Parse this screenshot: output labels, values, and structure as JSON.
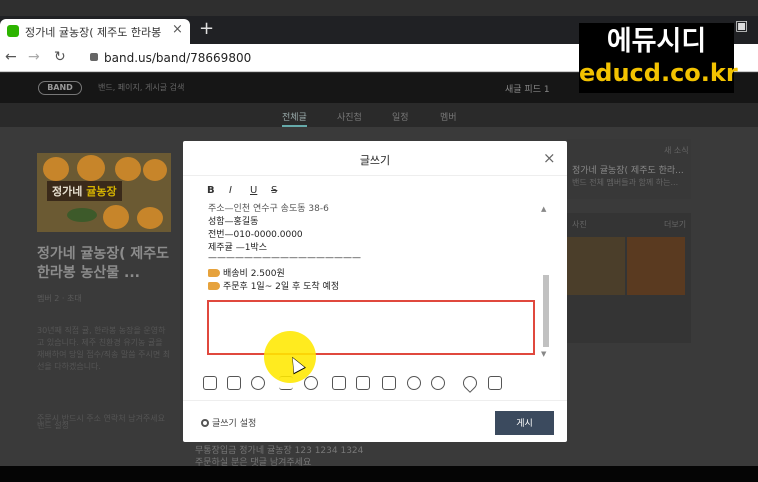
{
  "browser": {
    "tab_title": "정가네 귤농장( 제주도 한라봉 농",
    "tab_close": "×",
    "new_tab": "+",
    "url": "band.us/band/78669800",
    "back": "←",
    "forward": "→",
    "reload": "C"
  },
  "watermark": {
    "line1": "에듀시디",
    "line2": "educd.co.kr"
  },
  "band": {
    "logo": "BAND",
    "search_placeholder": "밴드, 페이지, 게시글 검색",
    "nav_right": "새글 피드  1",
    "tabs": [
      "전체글",
      "사진첩",
      "일정",
      "멤버"
    ],
    "cover_label_a": "정가네 ",
    "cover_label_b": "귤농장",
    "title": "정가네 귤농장( 제주도 한라봉 농산물 ...",
    "members": "멤버 2 · 초대",
    "description": "30년째 직접 귤, 한라봉 농장을 운영하고 있습니다. 제주 친환경 유기농 귤을 재배하여 당일 접수/직송 말씀 주시면 최선을 다하겠습니다.",
    "description2": "주문시 반드시 주소 연락처 남겨주세요",
    "foot": "밴드 설정",
    "new_news_header": "새 소식",
    "new_news_title": "정가네 귤농장( 제주도 한라...",
    "new_news_sub": "밴드 전체 멤버들과 함께 하는...",
    "photos_header": "사진",
    "photos_more": "더보기",
    "post_preview_1": "무통장입금 정가네 귤농장 123 1234 1324",
    "post_preview_2": "주문하실 분은 댓글 남겨주세요"
  },
  "modal": {
    "title": "글쓰기",
    "close": "×",
    "format": {
      "bold": "B",
      "italic": "I",
      "underline": "U",
      "strike": "S"
    },
    "editor_lines": [
      "주소—인천 연수구 송도동 38-6",
      "성함—홍길동",
      "전번—010-0000.0000",
      "제주귤 —1박스",
      "—————————————————",
      "배송비 2.500원",
      "주문후 1일~ 2일 후 도착 예정"
    ],
    "settings_label": "글쓰기 설정",
    "post_button": "게시",
    "attach_icons": [
      "image-icon",
      "sticker-icon",
      "video-icon",
      "file-icon",
      "attach-icon",
      "calendar-icon",
      "board-icon",
      "checklist-icon",
      "people-icon",
      "timer-icon",
      "location-icon",
      "markdown-icon"
    ]
  }
}
